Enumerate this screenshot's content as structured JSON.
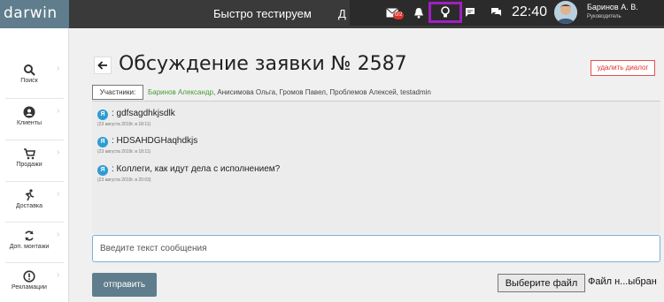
{
  "brand": "darwin",
  "topbar": {
    "title": "Быстро тестируем",
    "title_more": "Д",
    "badge": "0/2",
    "time": "22:40",
    "user_name": "Баринов А. В.",
    "user_role": "Руководитель",
    "highlight_color": "#a020c0"
  },
  "sidebar": {
    "items": [
      {
        "label": "Поиск",
        "icon": "search-icon"
      },
      {
        "label": "Клиенты",
        "icon": "person-icon"
      },
      {
        "label": "Продажи",
        "icon": "cart-icon"
      },
      {
        "label": "Доставка",
        "icon": "runner-icon"
      },
      {
        "label": "Доп. монтажи",
        "icon": "refresh-icon"
      },
      {
        "label": "Рекламации",
        "icon": "alert-icon"
      }
    ]
  },
  "page": {
    "title": "Обсуждение заявки № 2587",
    "close_label": "удалить диалог",
    "participants_label": "Участники:",
    "participant_first": "Баринов Александр",
    "participants_rest": ", Анисимова Ольга, Громов Павел, Проблемов Алексей, testadmin"
  },
  "messages": [
    {
      "avatar": "Я",
      "text": ": gdfsagdhkjsdlk",
      "date": "(23 августа 2019г. в 18:11)"
    },
    {
      "avatar": "Я",
      "text": ": HDSAHDGHaqhdkjs",
      "date": "(23 августа 2019г. в 18:11)"
    },
    {
      "avatar": "Я",
      "text": ": Коллеги, как идут дела с исполнением?",
      "date": "(23 августа 2019г. в 20:03)"
    }
  ],
  "composer": {
    "placeholder": "Введите текст сообщения",
    "send_label": "отправить",
    "file_button": "Выберите файл",
    "file_status": "Файл н...ыбран"
  }
}
